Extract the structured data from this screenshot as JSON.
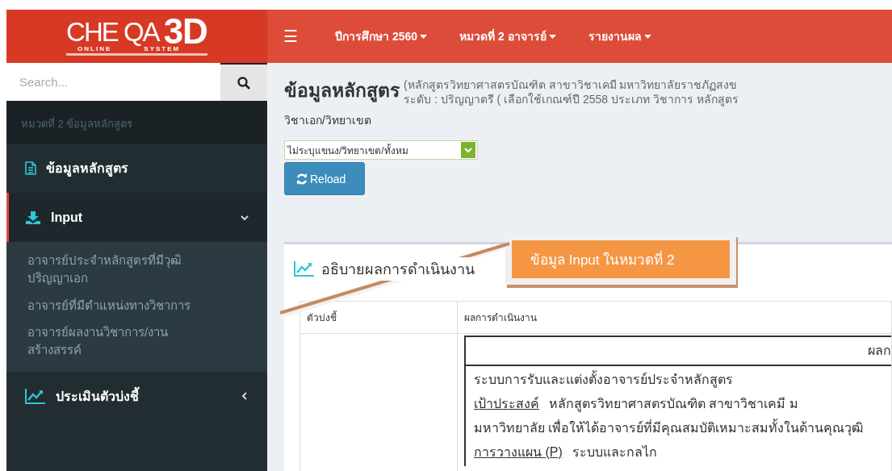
{
  "logo": {
    "title": "CHE QA",
    "big": "3D",
    "sub_left": "ONLINE",
    "sub_right": "SYSTEM"
  },
  "navbar": {
    "menu_icon": "☰",
    "menus": [
      {
        "label": "ปีการศึกษา 2560"
      },
      {
        "label": "หมวดที่ 2 อาจารย์"
      },
      {
        "label": "รายงานผล"
      }
    ]
  },
  "sidebar": {
    "search": {
      "placeholder": "Search..."
    },
    "section_label": "หมวดที่ 2 ข้อมูลหลักสูตร",
    "items": [
      {
        "label": "ข้อมูลหลักสูตร",
        "kind": "document",
        "selected": false
      },
      {
        "label": "Input",
        "kind": "download",
        "selected": true,
        "expanded": true,
        "children": [
          {
            "label": "อาจารย์ประจำหลักสูตรที่มีวุฒิปริญญาเอก"
          },
          {
            "label": "อาจารย์ที่มีตำแหน่งทางวิชาการ"
          },
          {
            "label": "อาจารย์ผลงานวิชาการ/งานสร้างสรรค์"
          }
        ]
      },
      {
        "label": "ประเมินตัวบ่งชี้",
        "kind": "chart",
        "selected": false,
        "expanded": false
      }
    ]
  },
  "page": {
    "title": "ข้อมูลหลักสูตร",
    "subtitle_lines": [
      "(หลักสูตรวิทยาศาสตรบัณฑิต สาขาวิชาเคมี มหาวิทยาลัยราชภัฏสงข",
      "ระดับ : ปริญญาตรี ( เลือกใช้เกณฑ์ปี 2558 ประเภท วิชาการ หลักสูตร"
    ],
    "field_label": "วิชาเอก/วิทยาเขต",
    "select_value": "ไม่ระบุแขนง/วิทยาเขต/ทั้งหม",
    "reload_button": "Reload"
  },
  "panel": {
    "title": "อธิบายผลการดำเนินงาน",
    "columns": [
      "ตัวบ่งชี้",
      "ผลการดำเนินงาน"
    ],
    "document": {
      "header": "ผลก",
      "heading": "ระบบการรับและแต่งตั้งอาจารย์ประจำหลักสูตร",
      "lines": [
        {
          "label": "เป้าประสงค์",
          "text": "หลักสูตรวิทยาศาสตรบัณฑิต สาขาวิชาเคมี ม"
        },
        {
          "text": "มหาวิทยาลัย เพื่อให้ได้อาจารย์ที่มีคุณสมบัติเหมาะสมทั้งในด้านคุณวุฒิ"
        },
        {
          "label": "การวางแผน (P)",
          "text": "ระบบและกลไก"
        }
      ]
    }
  },
  "callout": {
    "text": "ข้อมูล Input ในหมวดที่ 2"
  }
}
